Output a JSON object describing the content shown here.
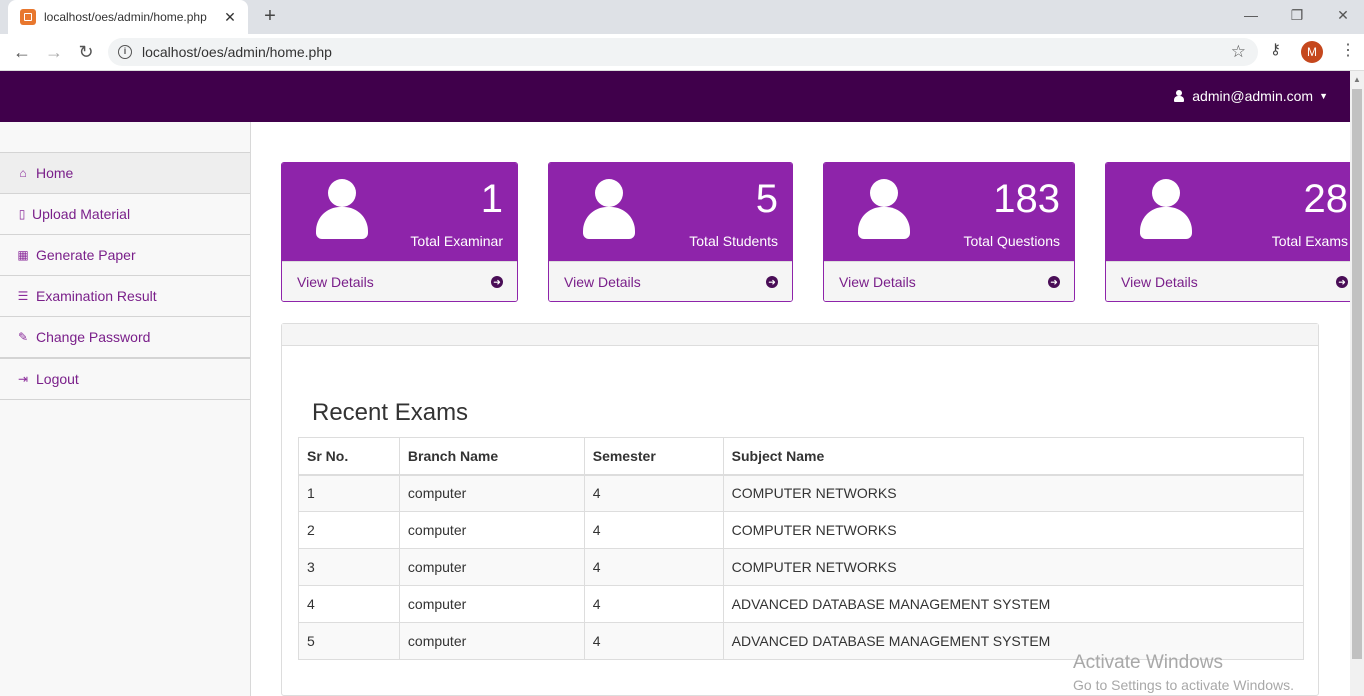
{
  "browser": {
    "tab_title": "localhost/oes/admin/home.php",
    "url": "localhost/oes/admin/home.php",
    "profile_initial": "M"
  },
  "header": {
    "user_email": "admin@admin.com"
  },
  "sidebar": {
    "items": [
      {
        "label": "Home",
        "icon": "home-icon"
      },
      {
        "label": "Upload Material",
        "icon": "file-icon"
      },
      {
        "label": "Generate Paper",
        "icon": "table-icon"
      },
      {
        "label": "Examination Result",
        "icon": "list-icon"
      },
      {
        "label": "Change Password",
        "icon": "edit-icon"
      },
      {
        "label": "Logout",
        "icon": "sign-out-icon"
      }
    ]
  },
  "cards": [
    {
      "count": "1",
      "label": "Total Examinar",
      "link": "View Details"
    },
    {
      "count": "5",
      "label": "Total Students",
      "link": "View Details"
    },
    {
      "count": "183",
      "label": "Total Questions",
      "link": "View Details"
    },
    {
      "count": "28",
      "label": "Total Exams",
      "link": "View Details"
    }
  ],
  "recent_exams": {
    "title": "Recent Exams",
    "columns": [
      "Sr No.",
      "Branch Name",
      "Semester",
      "Subject Name"
    ],
    "rows": [
      [
        "1",
        "computer",
        "4",
        "COMPUTER NETWORKS"
      ],
      [
        "2",
        "computer",
        "4",
        "COMPUTER NETWORKS"
      ],
      [
        "3",
        "computer",
        "4",
        "COMPUTER NETWORKS"
      ],
      [
        "4",
        "computer",
        "4",
        "ADVANCED DATABASE MANAGEMENT SYSTEM"
      ],
      [
        "5",
        "computer",
        "4",
        "ADVANCED DATABASE MANAGEMENT SYSTEM"
      ]
    ]
  },
  "watermark": {
    "line1": "Activate Windows",
    "line2": "Go to Settings to activate Windows."
  },
  "colors": {
    "header": "#40004b",
    "card": "#8e24aa",
    "link": "#7a1f8a"
  }
}
